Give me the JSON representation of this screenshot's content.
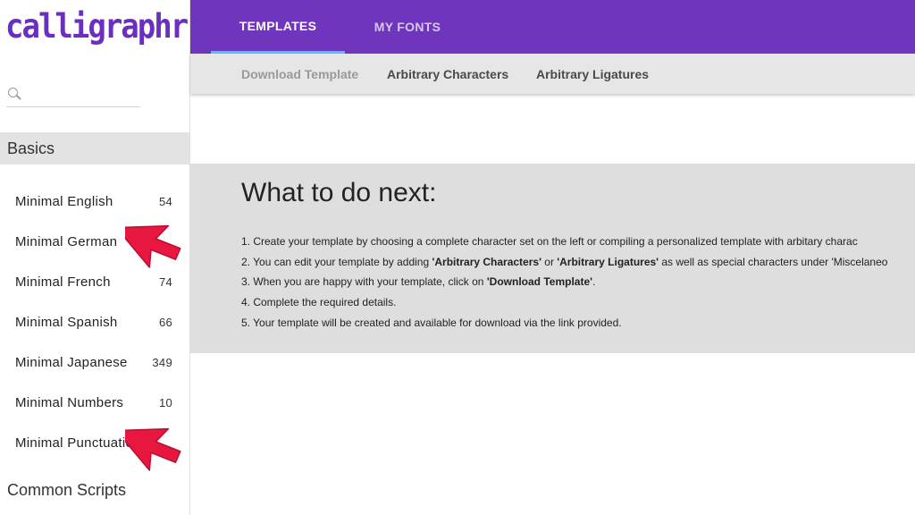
{
  "app": {
    "logo": "calligraphr"
  },
  "search": {
    "placeholder": "",
    "value": ""
  },
  "sidebar": {
    "section_basics": "Basics",
    "items": [
      {
        "label": "Minimal English",
        "count": "54"
      },
      {
        "label": "Minimal German",
        "count": ""
      },
      {
        "label": "Minimal French",
        "count": "74"
      },
      {
        "label": "Minimal Spanish",
        "count": "66"
      },
      {
        "label": "Minimal Japanese",
        "count": "349"
      },
      {
        "label": "Minimal Numbers",
        "count": "10"
      },
      {
        "label": "Minimal Punctuation",
        "count": ""
      }
    ],
    "section_common": "Common Scripts"
  },
  "topnav": {
    "tabs": [
      "TEMPLATES",
      "MY FONTS"
    ],
    "active": "TEMPLATES"
  },
  "subnav": {
    "tabs": [
      "Download Template",
      "Arbitrary Characters",
      "Arbitrary Ligatures"
    ]
  },
  "info": {
    "heading": "What to do next:",
    "steps": [
      {
        "n": "1.",
        "parts": [
          {
            "t": "Create your template by choosing a complete character set on the left or compiling a personalized template with arbitary charac",
            "b": false
          }
        ]
      },
      {
        "n": "2.",
        "parts": [
          {
            "t": "You can edit your template by adding ",
            "b": false
          },
          {
            "t": "'Arbitrary Characters'",
            "b": true
          },
          {
            "t": " or ",
            "b": false
          },
          {
            "t": "'Arbitrary Ligatures'",
            "b": true
          },
          {
            "t": " as well as special characters under 'Miscelaneo",
            "b": false
          }
        ]
      },
      {
        "n": "3.",
        "parts": [
          {
            "t": "When you are happy with your template, click on ",
            "b": false
          },
          {
            "t": "'Download Template'",
            "b": true
          },
          {
            "t": ".",
            "b": false
          }
        ]
      },
      {
        "n": "4.",
        "parts": [
          {
            "t": "Complete the required details.",
            "b": false
          }
        ]
      },
      {
        "n": "5.",
        "parts": [
          {
            "t": "Your template will be created and available for download via the link provided.",
            "b": false
          }
        ]
      }
    ]
  },
  "colors": {
    "brand": "#6f35bc",
    "tab_indicator": "#4fc3f7",
    "arrow": "#e8173f"
  },
  "icons": {
    "search": "search-icon",
    "pointer": "arrow-pointer-icon"
  }
}
